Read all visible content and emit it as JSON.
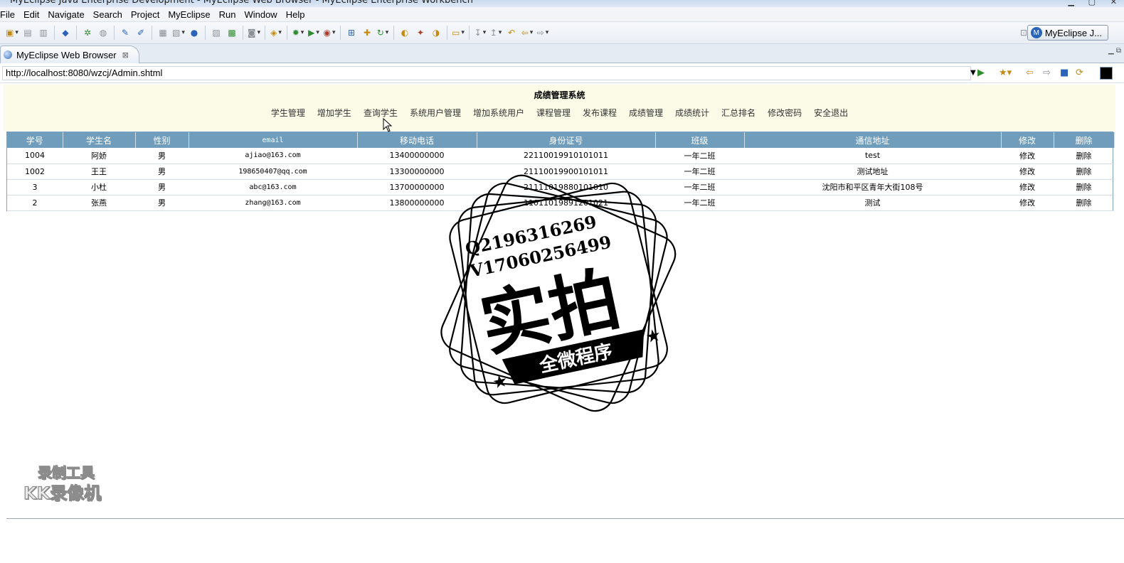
{
  "window": {
    "title": "MyEclipse Java Enterprise Development - MyEclipse Web Browser - MyEclipse Enterprise Workbench"
  },
  "menu": [
    "File",
    "Edit",
    "Navigate",
    "Search",
    "Project",
    "MyEclipse",
    "Run",
    "Window",
    "Help"
  ],
  "perspective": {
    "label": "MyEclipse J..."
  },
  "editor_tab": {
    "label": "MyEclipse Web Browser"
  },
  "browser": {
    "url": "http://localhost:8080/wzcj/Admin.shtml"
  },
  "site": {
    "title": "成绩管理系统",
    "nav": [
      "学生管理",
      "增加学生",
      "查询学生",
      "系统用户管理",
      "增加系统用户",
      "课程管理",
      "发布课程",
      "成绩管理",
      "成绩统计",
      "汇总排名",
      "修改密码",
      "安全退出"
    ]
  },
  "table": {
    "headers": [
      "学号",
      "学生名",
      "性别",
      "email",
      "移动电话",
      "身份证号",
      "班级",
      "通信地址",
      "修改",
      "删除"
    ],
    "rows": [
      [
        "1004",
        "阿娇",
        "男",
        "ajiao@163.com",
        "13400000000",
        "22110019910101011",
        "一年二班",
        "test",
        "修改",
        "删除"
      ],
      [
        "1002",
        "王王",
        "男",
        "198650407@qq.com",
        "13300000000",
        "21110019900101011",
        "一年二班",
        "测试地址",
        "修改",
        "删除"
      ],
      [
        "3",
        "小杜",
        "男",
        "abc@163.com",
        "13700000000",
        "21111019880101010",
        "一年二班",
        "沈阳市和平区青年大街108号",
        "修改",
        "删除"
      ],
      [
        "2",
        "张燕",
        "男",
        "zhang@163.com",
        "13800000000",
        "11011019891201021",
        "一年二班",
        "测试",
        "修改",
        "删除"
      ]
    ]
  },
  "watermark": {
    "line1": "Q2196316269",
    "line2": "V17060256499",
    "big": "实拍",
    "banner": "全微程序"
  },
  "recorder": {
    "line1": "录制工具",
    "line2": "KK录像机"
  }
}
